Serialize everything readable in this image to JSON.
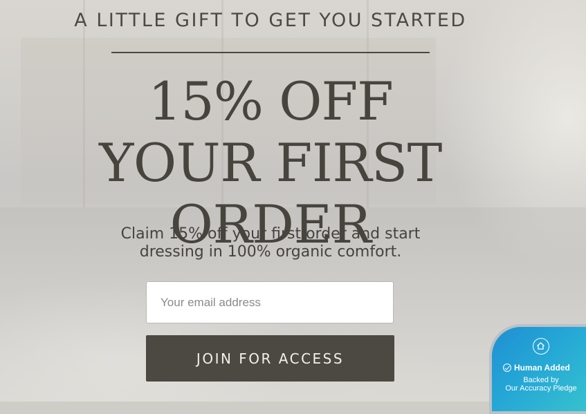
{
  "promo": {
    "kicker": "A LITTLE GIFT TO GET YOU STARTED",
    "headline_line1": "15% OFF",
    "headline_line2": "YOUR FIRST ORDER",
    "subtext_line1": "Claim 15% off your first order and start",
    "subtext_line2": "dressing in 100% organic comfort.",
    "email_placeholder": "Your email address",
    "email_value": "",
    "cta_label": "JOIN FOR ACCESS"
  },
  "trust_badge": {
    "icon": "home-icon",
    "status": "Human Added",
    "backed_line1": "Backed by",
    "backed_line2": "Our Accuracy Pledge",
    "colors": {
      "gradient_start": "#1f8fd1",
      "gradient_end": "#38c2cf"
    }
  },
  "colors": {
    "text_dark": "#46443d",
    "button_bg": "#4c4842",
    "button_text": "#f3f1ec"
  }
}
